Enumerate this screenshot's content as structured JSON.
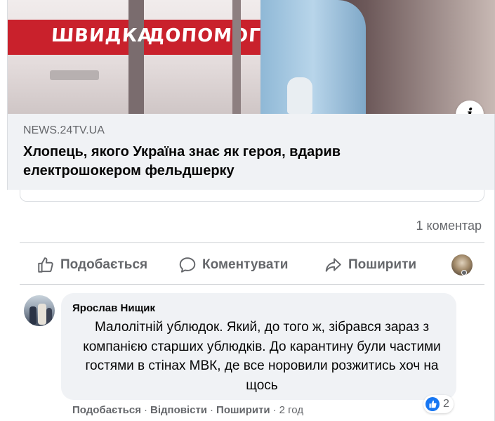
{
  "hero": {
    "sign_left": "ШВИДКА",
    "sign_right": "ДОПОМОГА",
    "info_icon": "i"
  },
  "preview": {
    "domain": "NEWS.24TV.UA",
    "headline": "Хлопець, якого Україна знає як героя, вдарив електрошокером фельдшерку"
  },
  "stats": {
    "comments": "1 коментар"
  },
  "actions": {
    "like": "Подобається",
    "comment": "Коментувати",
    "share": "Поширити"
  },
  "comment": {
    "author": "Ярослав Нищик",
    "text": "Малолітній ублюдок. Який, до того ж, зібрався зараз з компанією старших ублюдків. До карантину були частими гостями в стінах МВК, де все норовили розжитись хоч на щось",
    "like_link": "Подобається",
    "reply_link": "Відповісти",
    "share_link": "Поширити",
    "time": "2 год",
    "reaction_count": "2"
  },
  "colors": {
    "accent": "#1877f2",
    "muted_text": "#65676b",
    "bubble_bg": "#f0f2f5"
  },
  "icons": [
    "info-icon",
    "like-icon",
    "comment-icon",
    "share-icon",
    "like-reaction-icon"
  ]
}
